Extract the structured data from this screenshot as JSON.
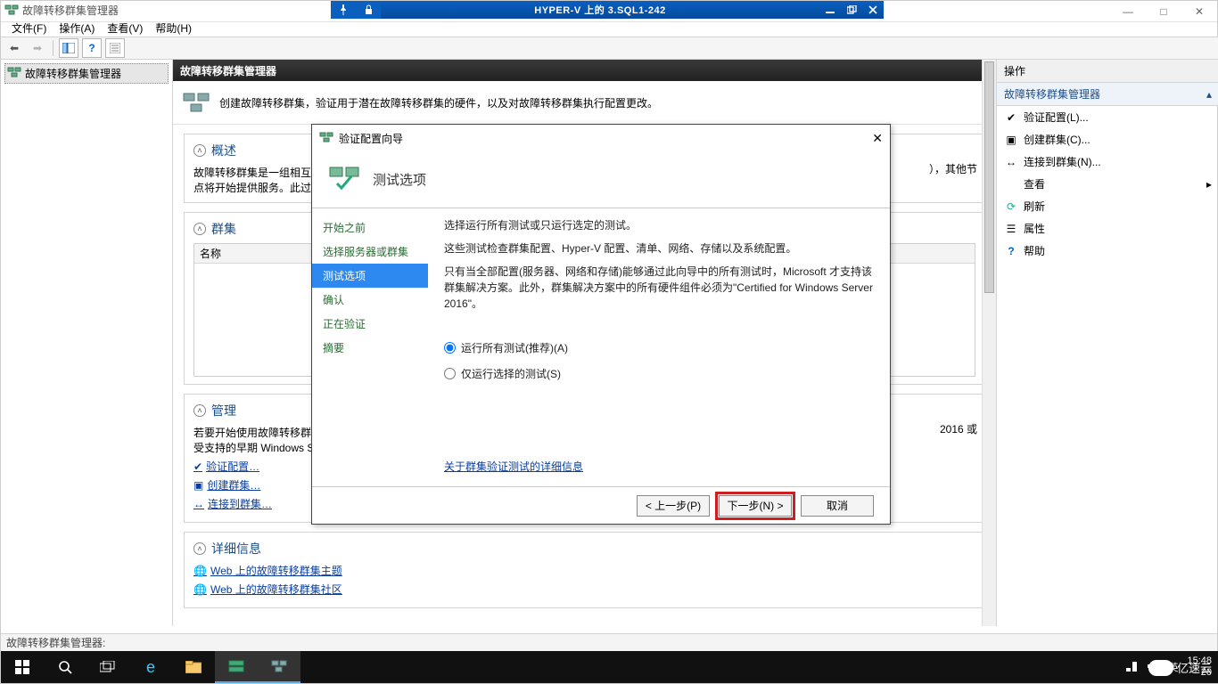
{
  "outer_window": {
    "minimize": "—",
    "maximize": "□",
    "close": "✕"
  },
  "remote_bar": {
    "title": "HYPER-V 上的 3.SQL1-242"
  },
  "app": {
    "title": "故障转移群集管理器",
    "menus": {
      "file": "文件(F)",
      "action": "操作(A)",
      "view": "查看(V)",
      "help": "帮助(H)"
    }
  },
  "tree": {
    "root": "故障转移群集管理器"
  },
  "center": {
    "header": "故障转移群集管理器",
    "intro": "创建故障转移群集，验证用于潜在故障转移群集的硬件，以及对故障转移群集执行配置更改。",
    "overview_title": "概述",
    "overview_body_1": "故障转移群集是一组相互…",
    "overview_body_2": "点将开始提供服务。此过…",
    "overview_tail": "），其他节",
    "clusters_title": "群集",
    "name_column": "名称",
    "manage_title": "管理",
    "manage_body_1": "若要开始使用故障转移群…",
    "manage_body_2": "受支持的早期 Windows S…",
    "manage_tail": "2016 或",
    "link_validate": "验证配置…",
    "link_create": "创建群集…",
    "link_connect": "连接到群集…",
    "details_title": "详细信息",
    "link_web1": "Web 上的故障转移群集主题",
    "link_web2": "Web 上的故障转移群集社区"
  },
  "actions": {
    "pane_title": "操作",
    "section": "故障转移群集管理器",
    "validate": "验证配置(L)...",
    "create": "创建群集(C)...",
    "connect": "连接到群集(N)...",
    "view": "查看",
    "refresh": "刷新",
    "properties": "属性",
    "help": "帮助"
  },
  "status_bar": "故障转移群集管理器:",
  "wizard": {
    "window_title": "验证配置向导",
    "banner_title": "测试选项",
    "steps": {
      "s1": "开始之前",
      "s2": "选择服务器或群集",
      "s3": "测试选项",
      "s4": "确认",
      "s5": "正在验证",
      "s6": "摘要"
    },
    "p1": "选择运行所有测试或只运行选定的测试。",
    "p2": "这些测试检查群集配置、Hyper-V 配置、清单、网络、存储以及系统配置。",
    "p3": "只有当全部配置(服务器、网络和存储)能够通过此向导中的所有测试时，Microsoft 才支持该群集解决方案。此外，群集解决方案中的所有硬件组件必须为\"Certified for Windows Server 2016\"。",
    "radio_all": "运行所有测试(推荐)(A)",
    "radio_sel": "仅运行选择的测试(S)",
    "link": "关于群集验证测试的详细信息",
    "btn_prev": "< 上一步(P)",
    "btn_next": "下一步(N) >",
    "btn_cancel": "取消"
  },
  "taskbar": {
    "time": "15:48",
    "date_short": "20",
    "ime": "英"
  },
  "watermark": "亿速云"
}
